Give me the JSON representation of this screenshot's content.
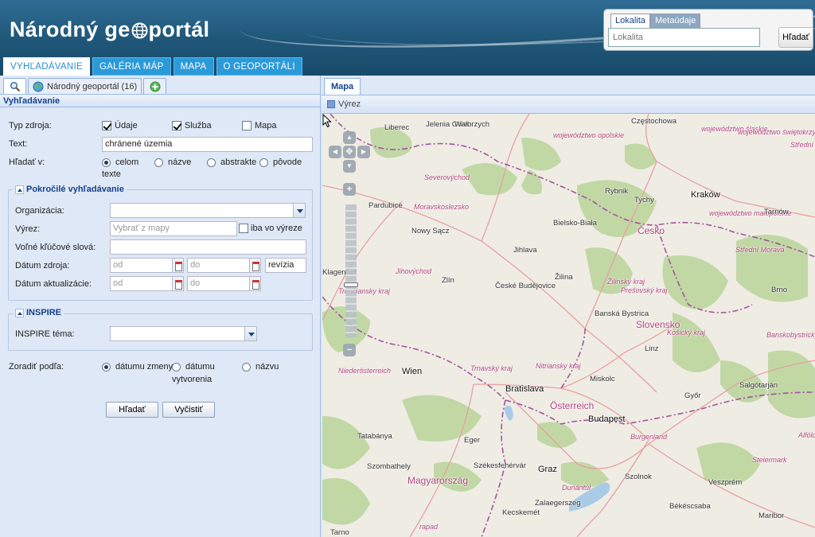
{
  "app": {
    "logo_left": "Národný ge",
    "logo_right": "portál"
  },
  "header_search": {
    "tab_location": "Lokalita",
    "tab_metadata": "Metaúdaje",
    "placeholder": "Lokalita",
    "button": "Hľadať"
  },
  "nav": {
    "tabs": [
      "VYHĽADÁVANIE",
      "GALÉRIA MÁP",
      "MAPA",
      "O GEOPORTÁLI"
    ],
    "active": "VYHĽADÁVANIE"
  },
  "left_tabs": {
    "portal": "Národný geoportál (16)"
  },
  "search_form": {
    "title": "Vyhľadávanie",
    "source_type_label": "Typ zdroja:",
    "source_types": [
      {
        "label": "Údaje",
        "checked": true
      },
      {
        "label": "Služba",
        "checked": true
      },
      {
        "label": "Mapa",
        "checked": false
      }
    ],
    "text_label": "Text:",
    "text_value": "chránené územia",
    "search_in_label": "Hľadať v:",
    "search_in": [
      {
        "label": "celom",
        "label2": "texte",
        "checked": true
      },
      {
        "label": "názve",
        "checked": false
      },
      {
        "label": "abstrakte",
        "checked": false
      },
      {
        "label": "pôvode",
        "checked": false
      }
    ],
    "advanced": {
      "legend": "Pokročilé vyhľadávanie",
      "organization_label": "Organizácia:",
      "extent_label": "Výrez:",
      "extent_placeholder": "Vybrať z mapy",
      "extent_only_label": "iba vo výreze",
      "keywords_label": "Voľné kľúčové slová:",
      "source_date_label": "Dátum zdroja:",
      "update_date_label": "Dátum aktualizácie:",
      "from_placeholder": "od",
      "to_placeholder": "do",
      "revision": "revízia"
    },
    "inspire": {
      "legend": "INSPIRE",
      "theme_label": "INSPIRE téma:"
    },
    "sort_label": "Zoradiť podľa:",
    "sort_options": [
      {
        "label": "dátumu zmeny",
        "checked": true
      },
      {
        "label": "dátumu",
        "label2": "vytvorenia",
        "checked": false
      },
      {
        "label": "názvu",
        "checked": false
      }
    ],
    "search_button": "Hľadať",
    "clear_button": "Vyčistiť"
  },
  "map_panel": {
    "tab": "Mapa",
    "toolbar_extent": "Výrez",
    "labels": [
      {
        "text": "Częstochowa",
        "kind": "place"
      },
      {
        "text": "województwo śląskie",
        "kind": "region"
      },
      {
        "text": "województwo świętokrzyskie",
        "kind": "region"
      },
      {
        "text": "województwo opolskie",
        "kind": "region"
      },
      {
        "text": "województwo małopolskie",
        "kind": "region"
      },
      {
        "text": "Liberec",
        "kind": "place"
      },
      {
        "text": "Jelenia Góra",
        "kind": "place"
      },
      {
        "text": "Wałbrzych",
        "kind": "place"
      },
      {
        "text": "Severovýchod",
        "kind": "region"
      },
      {
        "text": "Rybnik",
        "kind": "place"
      },
      {
        "text": "Tychy",
        "kind": "place"
      },
      {
        "text": "Kraków",
        "kind": "city"
      },
      {
        "text": "Tarnów",
        "kind": "place"
      },
      {
        "text": "Střední Čechy",
        "kind": "region"
      },
      {
        "text": "Pardubice",
        "kind": "place"
      },
      {
        "text": "Moravskoslezsko",
        "kind": "region"
      },
      {
        "text": "Bielsko-Biała",
        "kind": "place"
      },
      {
        "text": "Česko",
        "kind": "country"
      },
      {
        "text": "Nowy Sącz",
        "kind": "place"
      },
      {
        "text": "Střední Morava",
        "kind": "region"
      },
      {
        "text": "Jihlava",
        "kind": "place"
      },
      {
        "text": "Jihovýchod",
        "kind": "region"
      },
      {
        "text": "Zlín",
        "kind": "place"
      },
      {
        "text": "Žilina",
        "kind": "place"
      },
      {
        "text": "Žilinský kraj",
        "kind": "region"
      },
      {
        "text": "Prešovský kraj",
        "kind": "region"
      },
      {
        "text": "Brno",
        "kind": "place"
      },
      {
        "text": "České Budějovice",
        "kind": "place"
      },
      {
        "text": "Trenčiansky kraj",
        "kind": "region"
      },
      {
        "text": "Banská Bystrica",
        "kind": "place"
      },
      {
        "text": "Slovensko",
        "kind": "country"
      },
      {
        "text": "Košický kraj",
        "kind": "region"
      },
      {
        "text": "Banskobystrický kraj",
        "kind": "region"
      },
      {
        "text": "Linz",
        "kind": "place"
      },
      {
        "text": "Niederösterreich",
        "kind": "region"
      },
      {
        "text": "Wien",
        "kind": "city"
      },
      {
        "text": "Trnavský kraj",
        "kind": "region"
      },
      {
        "text": "Bratislava",
        "kind": "city"
      },
      {
        "text": "Nitriansky kraj",
        "kind": "region"
      },
      {
        "text": "Miskolc",
        "kind": "place"
      },
      {
        "text": "Salgótarján",
        "kind": "place"
      },
      {
        "text": "Győr",
        "kind": "place"
      },
      {
        "text": "Österreich",
        "kind": "country"
      },
      {
        "text": "Tatabánya",
        "kind": "place"
      },
      {
        "text": "Budapest",
        "kind": "city"
      },
      {
        "text": "Burgenland",
        "kind": "region"
      },
      {
        "text": "Eger",
        "kind": "place"
      },
      {
        "text": "Alföld és Észak",
        "kind": "region"
      },
      {
        "text": "Steiermark",
        "kind": "region"
      },
      {
        "text": "Szombathely",
        "kind": "place"
      },
      {
        "text": "Székesfehérvár",
        "kind": "place"
      },
      {
        "text": "Graz",
        "kind": "city"
      },
      {
        "text": "Magyarország",
        "kind": "country"
      },
      {
        "text": "Szolnok",
        "kind": "place"
      },
      {
        "text": "Veszprém",
        "kind": "place"
      },
      {
        "text": "Dunántúl",
        "kind": "region"
      },
      {
        "text": "Zalaegerszeg",
        "kind": "place"
      },
      {
        "text": "Kecskemét",
        "kind": "place"
      },
      {
        "text": "Békéscsaba",
        "kind": "place"
      },
      {
        "text": "Maribor",
        "kind": "place"
      },
      {
        "text": "rapad",
        "kind": "region"
      },
      {
        "text": "Klagenfurt",
        "kind": "place"
      },
      {
        "text": "Tarno",
        "kind": "place"
      }
    ]
  },
  "colors": {
    "header": "#1f5678",
    "nav_tab": "#2b9ad9",
    "panel_bg": "#dfe8f6",
    "panel_title": "#15428b",
    "map_bg": "#efece4",
    "forest": "#b9d59b",
    "border_line": "#a3559c",
    "road": "#e8a0a0"
  }
}
